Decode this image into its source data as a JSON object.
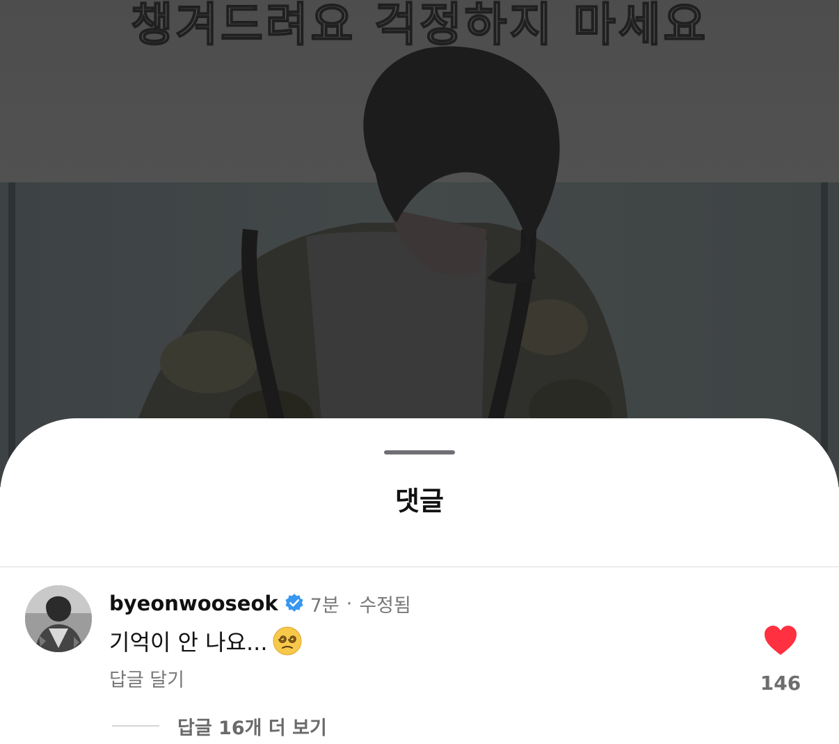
{
  "video": {
    "subtitle": "챙겨드려요 걱정하지 마세요"
  },
  "sheet": {
    "title": "댓글"
  },
  "comment": {
    "username": "byeonwooseok",
    "verified_icon": "verified-badge-icon",
    "time": "7분",
    "separator": "·",
    "edited": "수정됨",
    "text": "기억이 안 나요...",
    "emoji": "dizzy-face-emoji",
    "reply_label": "답글 달기",
    "like_icon": "heart-filled-icon",
    "like_count": "146",
    "view_replies_label": "답글 16개 더 보기"
  },
  "colors": {
    "like_red": "#ff3040",
    "verified_blue": "#3897f0",
    "secondary_text": "#777777"
  }
}
